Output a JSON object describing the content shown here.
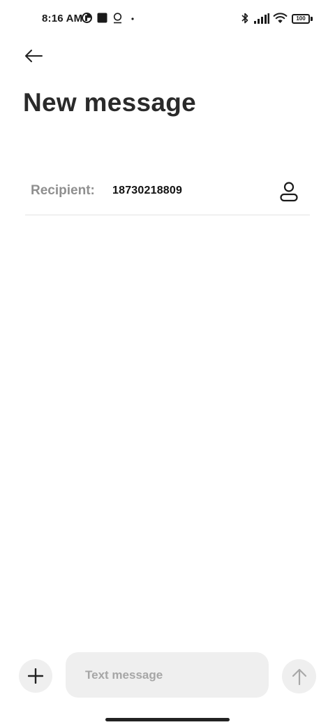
{
  "status_bar": {
    "time": "8:16 AM",
    "battery_level": "100",
    "icons": [
      "hotspot-icon",
      "stop-square-icon",
      "location-icon",
      "dot-icon",
      "bluetooth-icon",
      "signal-icon",
      "wifi-icon",
      "battery-icon"
    ]
  },
  "header": {
    "back_icon": "arrow-left-icon",
    "title": "New message"
  },
  "recipient": {
    "label": "Recipient:",
    "value": "18730218809",
    "contact_icon": "person-icon"
  },
  "composer": {
    "add_icon": "plus-icon",
    "placeholder": "Text message",
    "value": "",
    "send_icon": "arrow-up-icon"
  },
  "colors": {
    "background": "#ffffff",
    "label_gray": "#8f8f8f",
    "control_bg": "#efefef",
    "text_dark": "#222222"
  }
}
